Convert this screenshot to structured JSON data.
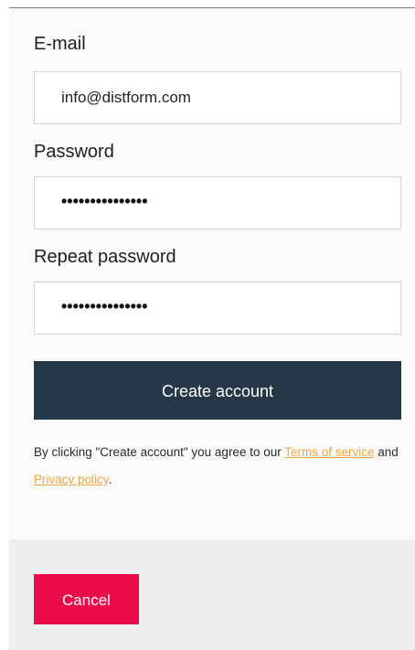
{
  "form": {
    "email": {
      "label": "E-mail",
      "value": "info@distform.com"
    },
    "password": {
      "label": "Password",
      "value": "•••••••••••••••"
    },
    "repeat_password": {
      "label": "Repeat password",
      "value": "•••••••••••••••"
    },
    "submit_label": "Create account",
    "legal": {
      "prefix": "By clicking \"Create account\" you agree to our ",
      "terms_link": "Terms of service",
      "middle": " and ",
      "privacy_link": "Privacy policy",
      "suffix": "."
    }
  },
  "footer": {
    "cancel_label": "Cancel"
  },
  "colors": {
    "primary_button": "#263848",
    "cancel_button": "#eb0a4a",
    "link": "#f3a53c"
  }
}
